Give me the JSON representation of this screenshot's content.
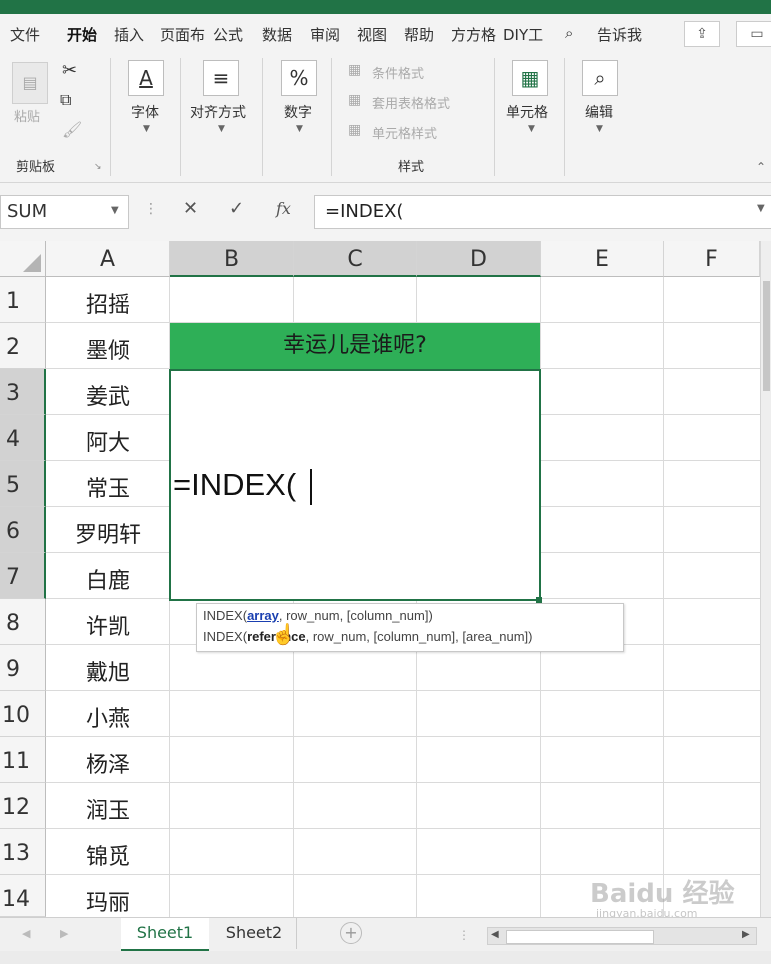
{
  "ribbon_tabs": [
    "文件",
    "开始",
    "插入",
    "页面布",
    "公式",
    "数据",
    "审阅",
    "视图",
    "帮助",
    "方方格",
    "DIY工",
    "告诉我"
  ],
  "clipboard": {
    "paste": "粘贴",
    "group": "剪贴板"
  },
  "font": {
    "label": "字体",
    "icon_char": "A"
  },
  "alignment": {
    "label": "对齐方式"
  },
  "number": {
    "label": "数字",
    "icon_char": "%"
  },
  "styles": {
    "conditional": "条件格式",
    "table": "套用表格格式",
    "cell": "单元格样式",
    "group": "样式"
  },
  "cells": {
    "label": "单元格"
  },
  "editing": {
    "label": "编辑"
  },
  "formula_bar": {
    "name_box": "SUM",
    "cancel": "✕",
    "enter": "✓",
    "fx": "fx",
    "formula": "=INDEX("
  },
  "columns": [
    "A",
    "B",
    "C",
    "D",
    "E",
    "F"
  ],
  "rows": [
    "1",
    "2",
    "3",
    "4",
    "5",
    "6",
    "7",
    "8",
    "9",
    "10",
    "11",
    "12",
    "13",
    "14"
  ],
  "names": [
    "招摇",
    "墨倾",
    "姜武",
    "阿大",
    "常玉",
    "罗明轩",
    "白鹿",
    "许凯",
    "戴旭",
    "小燕",
    "杨泽",
    "润玉",
    "锦觅",
    "玛丽"
  ],
  "header_cell": "幸运儿是谁呢?",
  "edit_cell": "=INDEX(",
  "tooltip": {
    "line1_prefix": "INDEX(",
    "line1_bold": "array",
    "line1_rest": ", row_num, [column_num])",
    "line2_prefix": "INDEX(",
    "line2_bold": "reference",
    "line2_rest": ", row_num, [column_num], [area_num])"
  },
  "sheets": [
    "Sheet1",
    "Sheet2"
  ],
  "watermark": "Baidu 经验",
  "watermark_sub": "jingyan.baidu.com",
  "colors": {
    "accent": "#217346",
    "header_fill": "#2eaf57"
  }
}
